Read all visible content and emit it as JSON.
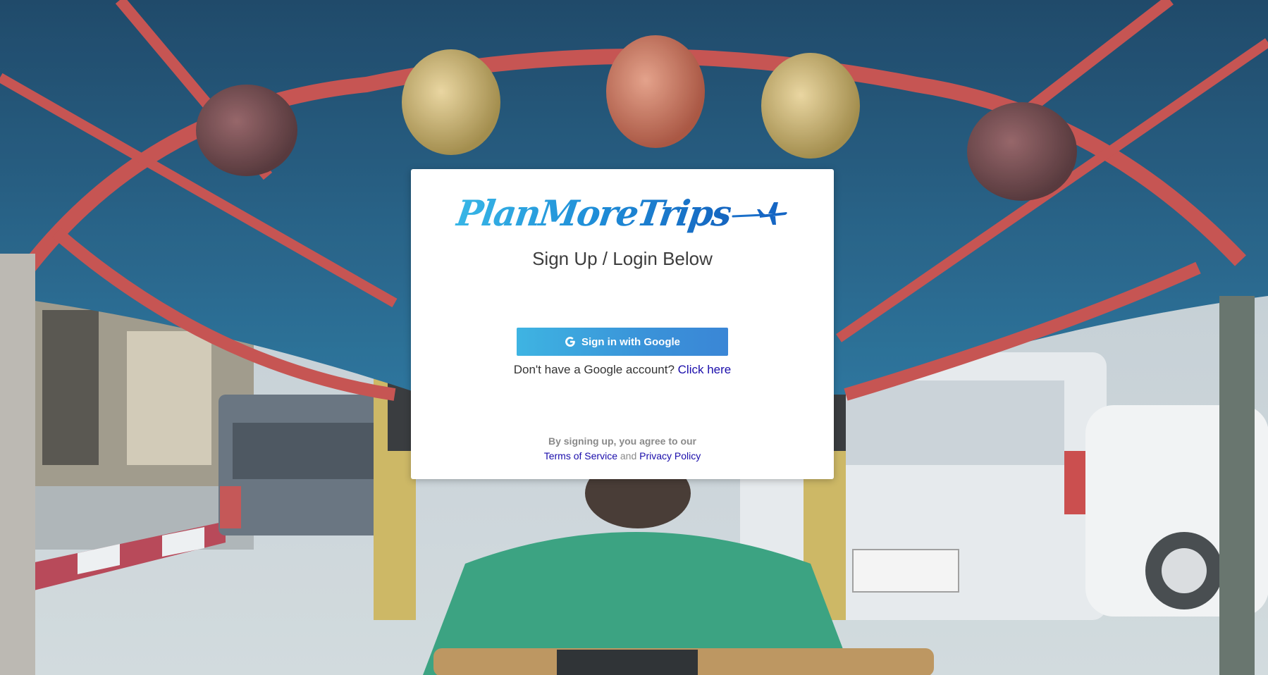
{
  "brand": {
    "logo_text": "PlanMoreTrips",
    "logo_icon": "airplane-icon",
    "gradient_start": "#38b6e6",
    "gradient_end": "#1565c0"
  },
  "card": {
    "title": "Sign Up / Login Below",
    "google_button_label": "Sign in with Google",
    "google_icon": "google-g-icon",
    "no_account_text": "Don't have a Google account?",
    "no_account_link": "Click here",
    "agreement_text": "By signing up, you agree to our",
    "terms_link": "Terms of Service",
    "and_text": "and",
    "privacy_link": "Privacy Policy"
  },
  "colors": {
    "button_start": "#3eb4e2",
    "button_end": "#3a86d6",
    "link": "#1a0dab",
    "title": "#3d3d3d"
  }
}
